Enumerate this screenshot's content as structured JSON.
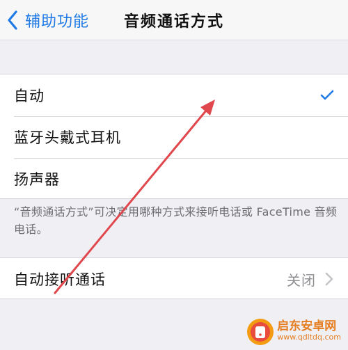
{
  "navbar": {
    "back_label": "辅助功能",
    "title": "音频通话方式"
  },
  "options": [
    {
      "label": "自动",
      "selected": true
    },
    {
      "label": "蓝牙头戴式耳机",
      "selected": false
    },
    {
      "label": "扬声器",
      "selected": false
    }
  ],
  "footer_note": "“音频通话方式”可决定用哪种方式来接听电话或 FaceTime 音频电话。",
  "auto_answer": {
    "label": "自动接听通话",
    "value": "关闭"
  },
  "watermark": {
    "name": "启东安卓网",
    "url": "www.qdltdq.com"
  },
  "colors": {
    "accent": "#1f7ae6",
    "annotation_arrow": "#e0474c",
    "watermark": "#e67e22"
  }
}
